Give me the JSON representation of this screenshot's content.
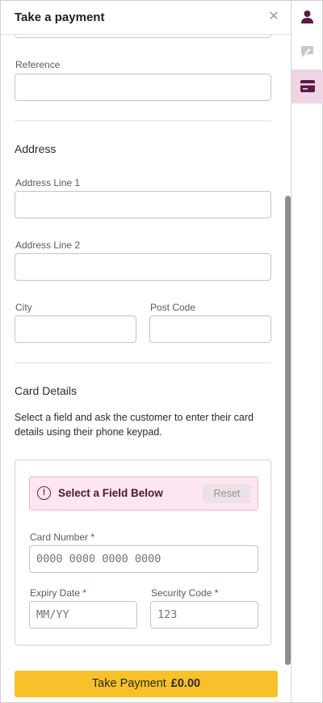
{
  "panel": {
    "title": "Take a payment",
    "close_icon": "close-icon"
  },
  "form": {
    "reference_label": "Reference",
    "reference_value": "",
    "address_title": "Address",
    "address_line1_label": "Address Line 1",
    "address_line1_value": "",
    "address_line2_label": "Address Line 2",
    "address_line2_value": "",
    "city_label": "City",
    "city_value": "",
    "postcode_label": "Post Code",
    "postcode_value": ""
  },
  "card": {
    "title": "Card Details",
    "help_text": "Select a field and ask the customer to enter their card details using their phone keypad.",
    "alert_text": "Select a Field Below",
    "alert_icon": "exclamation-circle-icon",
    "reset_label": "Reset",
    "card_number_label": "Card Number",
    "card_number_placeholder": "0000 0000 0000 0000",
    "expiry_label": "Expiry Date",
    "expiry_placeholder": "MM/YY",
    "security_label": "Security Code",
    "security_placeholder": "123",
    "required_mark": "*"
  },
  "footer": {
    "pay_label": "Take Payment",
    "pay_amount": "£0.00"
  },
  "rail": {
    "items": [
      {
        "icon": "person-icon",
        "active": false
      },
      {
        "icon": "chat-edit-icon",
        "active": false
      },
      {
        "icon": "credit-card-icon",
        "active": true
      }
    ]
  },
  "colors": {
    "accent": "#5c1a43",
    "rail_active_bg": "#efd4e4",
    "alert_bg": "#fce6f1",
    "pay_button": "#f8c12a",
    "required": "#c0204b"
  }
}
